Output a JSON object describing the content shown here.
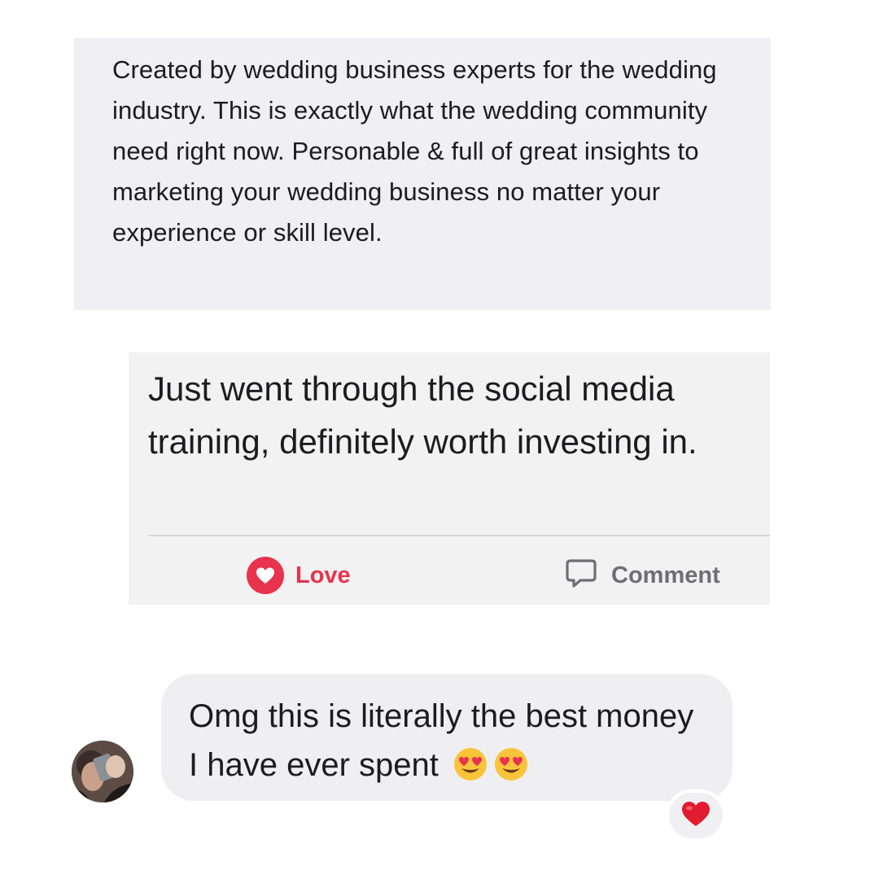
{
  "review": {
    "text": "Created by wedding business experts for the wedding industry. This is exactly what the wedding community need right now. Personable & full of great insights to marketing your wedding business no matter your experience or skill level."
  },
  "post": {
    "text": "Just went through the social media training, definitely worth investing in.",
    "love_label": "Love",
    "comment_label": "Comment",
    "love_icon": "heart-circle-icon",
    "comment_icon": "speech-bubble-icon",
    "love_color": "#e8334f",
    "comment_color": "#6e6e73"
  },
  "message": {
    "text": "Omg this is literally the best money I have ever spent",
    "emojis": [
      "heart-eyes-emoji",
      "heart-eyes-emoji"
    ],
    "reaction": "red-heart-emoji"
  },
  "colors": {
    "review_bg": "#efeff4",
    "post_bg": "#f2f2f2",
    "bubble_bg": "#efeff1"
  }
}
